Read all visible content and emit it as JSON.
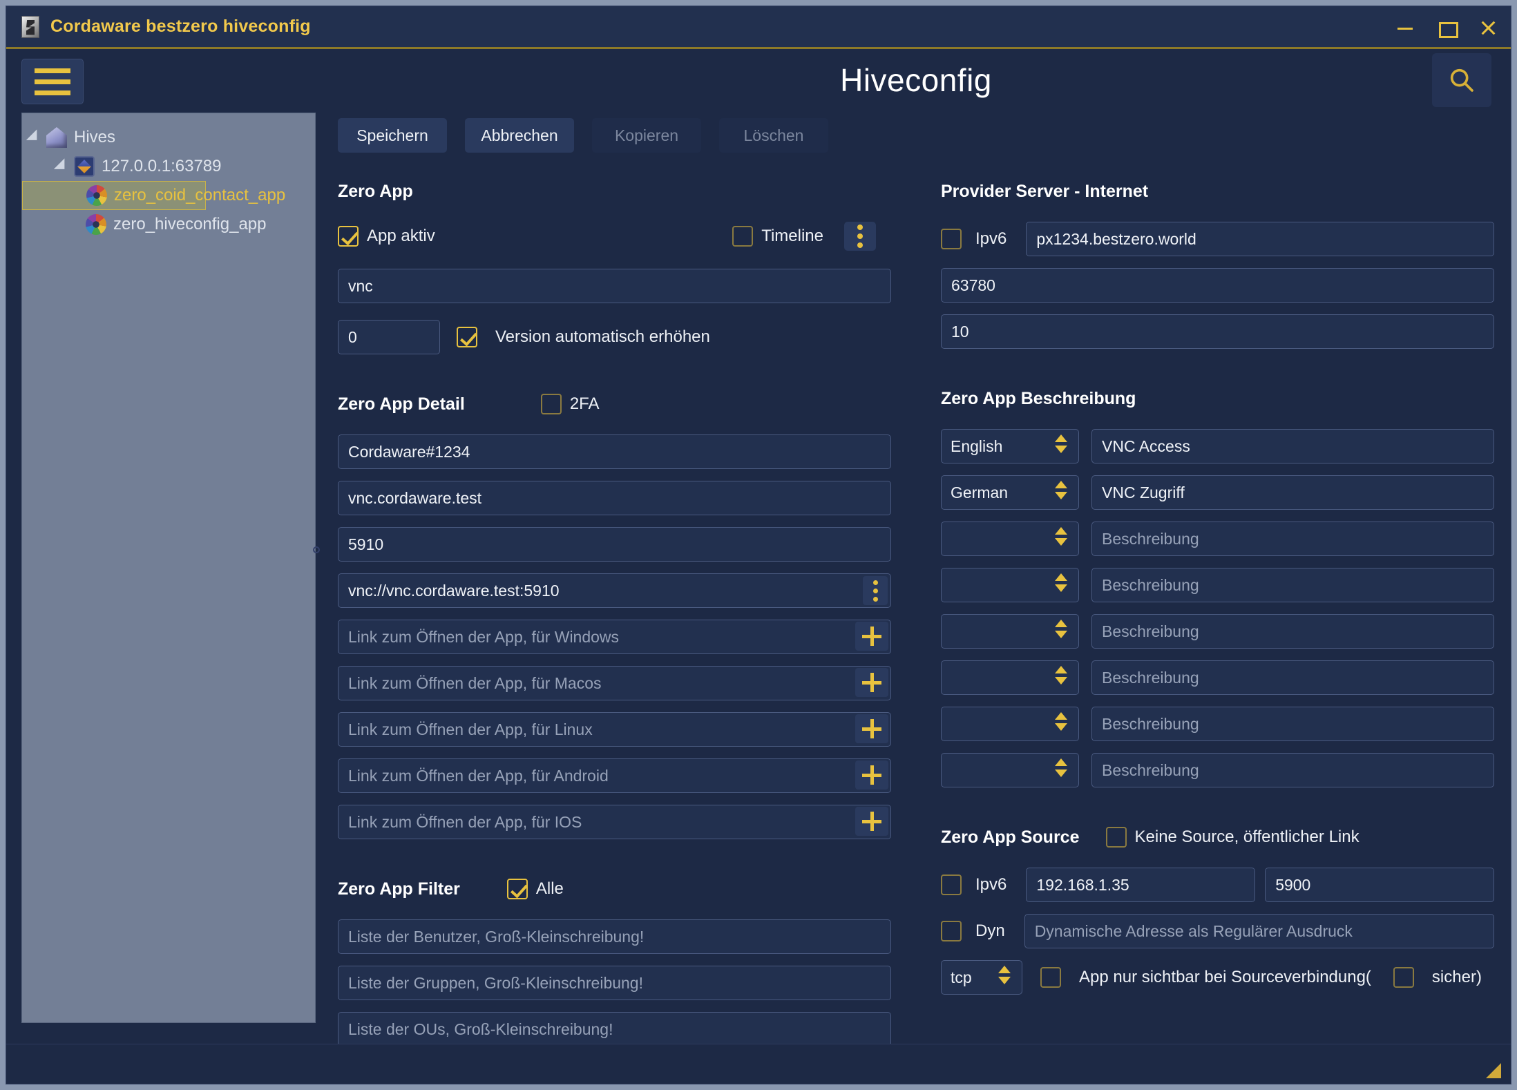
{
  "window": {
    "title": "Cordaware bestzero hiveconfig",
    "icon": "app-icon",
    "controls": {
      "minimize": "–",
      "maximize": "□",
      "close": "✕"
    }
  },
  "sidebar": {
    "menu_button": "hamburger-icon",
    "tree": [
      {
        "label": "Hives",
        "icon": "house-icon",
        "level": 1,
        "expanded": true,
        "selected": false
      },
      {
        "label": "127.0.0.1:63789",
        "icon": "hive-icon",
        "level": 2,
        "expanded": true,
        "selected": false
      },
      {
        "label": "zero_coid_contact_app",
        "icon": "flower-icon",
        "level": 3,
        "expanded": false,
        "selected": true
      },
      {
        "label": "zero_hiveconfig_app",
        "icon": "flower-icon",
        "level": 3,
        "expanded": false,
        "selected": false
      }
    ]
  },
  "header": {
    "title": "Hiveconfig",
    "search_icon": "search-icon"
  },
  "toolbar": {
    "save": "Speichern",
    "cancel": "Abbrechen",
    "copy": "Kopieren",
    "delete": "Löschen"
  },
  "zero_app": {
    "title": "Zero App",
    "app_active_label": "App aktiv",
    "app_active_checked": true,
    "timeline_label": "Timeline",
    "timeline_checked": false,
    "menu_icon": "kebab-menu-icon",
    "name_value": "vnc",
    "name_placeholder": "",
    "version_value": "0",
    "auto_version_label": "Version automatisch erhöhen",
    "auto_version_checked": true
  },
  "zero_app_detail": {
    "title": "Zero App Detail",
    "twofa_label": "2FA",
    "twofa_checked": false,
    "field1_value": "Cordaware#1234",
    "field2_value": "vnc.cordaware.test",
    "field3_value": "5910",
    "field4_value": "vnc://vnc.cordaware.test:5910",
    "field4_menu_icon": "kebab-menu-icon",
    "links": [
      {
        "placeholder": "Link zum Öffnen der App, für Windows",
        "add_icon": "plus-icon"
      },
      {
        "placeholder": "Link zum Öffnen der App, für Macos",
        "add_icon": "plus-icon"
      },
      {
        "placeholder": "Link zum Öffnen der App, für Linux",
        "add_icon": "plus-icon"
      },
      {
        "placeholder": "Link zum Öffnen der App, für Android",
        "add_icon": "plus-icon"
      },
      {
        "placeholder": "Link zum Öffnen der App, für IOS",
        "add_icon": "plus-icon"
      }
    ]
  },
  "zero_app_filter": {
    "title": "Zero App Filter",
    "all_label": "Alle",
    "all_checked": true,
    "users_placeholder": "Liste der Benutzer, Groß-Kleinschreibung!",
    "groups_placeholder": "Liste der Gruppen, Groß-Kleinschreibung!",
    "ous_placeholder": "Liste der OUs, Groß-Kleinschreibung!"
  },
  "provider_server": {
    "title": "Provider Server - Internet",
    "ipv6_label": "Ipv6",
    "ipv6_checked": false,
    "host_value": "px1234.bestzero.world",
    "port_value": "63780",
    "retry_value": "10"
  },
  "zero_app_beschreibung": {
    "title": "Zero App Beschreibung",
    "rows": [
      {
        "language": "English",
        "description": "VNC Access",
        "placeholder": "Beschreibung"
      },
      {
        "language": "German",
        "description": "VNC Zugriff",
        "placeholder": "Beschreibung"
      },
      {
        "language": "",
        "description": "",
        "placeholder": "Beschreibung"
      },
      {
        "language": "",
        "description": "",
        "placeholder": "Beschreibung"
      },
      {
        "language": "",
        "description": "",
        "placeholder": "Beschreibung"
      },
      {
        "language": "",
        "description": "",
        "placeholder": "Beschreibung"
      },
      {
        "language": "",
        "description": "",
        "placeholder": "Beschreibung"
      },
      {
        "language": "",
        "description": "",
        "placeholder": "Beschreibung"
      }
    ]
  },
  "zero_app_source": {
    "title": "Zero App Source",
    "no_source_label": "Keine Source, öffentlicher Link",
    "no_source_checked": false,
    "ipv6_label": "Ipv6",
    "ipv6_checked": false,
    "address_value": "192.168.1.35",
    "port_value": "5900",
    "dyn_label": "Dyn",
    "dyn_checked": false,
    "dyn_placeholder": "Dynamische Adresse als Regulärer Ausdruck",
    "protocol_value": "tcp",
    "visible_label": "App nur sichtbar bei Sourceverbindung(",
    "visible_checked": false,
    "secure_label": "sicher)",
    "secure_checked": false
  },
  "colors": {
    "accent": "#e8c23f",
    "window_bg": "#1d2945",
    "field_bg": "#22304f",
    "tree_bg": "#737f96",
    "selected_row": "#8b9176"
  }
}
